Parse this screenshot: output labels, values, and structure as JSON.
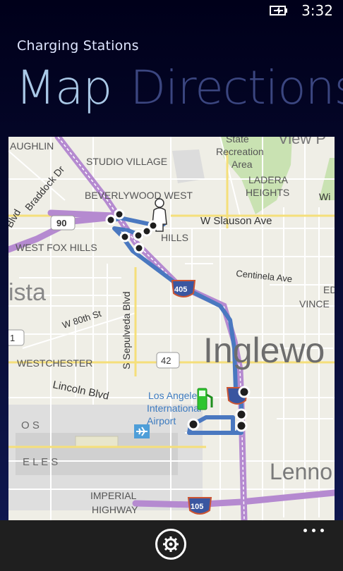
{
  "status_bar": {
    "time": "3:32",
    "battery_icon": "battery-charging-icon"
  },
  "app": {
    "title": "Charging Stations"
  },
  "pivot": {
    "active": "Map",
    "inactive": "Directions"
  },
  "map": {
    "labels": {
      "laughlin": "AUGHLIN",
      "studio_village": "STUDIO VILLAGE",
      "state": "State",
      "recreation": "Recreation",
      "area": "Area",
      "view": "View P",
      "braddock": "Braddock Dr",
      "ladera": "LADERA",
      "heights": "HEIGHTS",
      "beverlywood": "BEVERLYWOOD WEST",
      "w_short": "Wi",
      "blvd": "Blvd",
      "hwy90": "90",
      "slauson": "W Slauson Ave",
      "hills": "HILLS",
      "west_fox_hills": "WEST FOX HILLS",
      "centinela": "Centinela Ave",
      "ista": "ista",
      "i405": "405",
      "ed": "ED",
      "vince": "VINCE",
      "sepulveda": "S Sepulveda Blvd",
      "w80": "W 80th St",
      "hwy1": "1",
      "inglewood": "Inglewo",
      "westchester": "WESTCHESTER",
      "hwy42": "42",
      "lincoln": "Lincoln Blvd",
      "airport1": "Los Angeles",
      "airport2": "International",
      "airport3": "Airport",
      "os": "O  S",
      "eles": "E  L  E  S",
      "lenno": "Lenno",
      "imperial": "IMPERIAL",
      "highway": "HIGHWAY",
      "i105": "105"
    },
    "route_color": "#4a78c0",
    "stop_count": 11
  },
  "app_bar": {
    "settings_icon": "gear-icon",
    "more_icon": "ellipsis-icon"
  }
}
